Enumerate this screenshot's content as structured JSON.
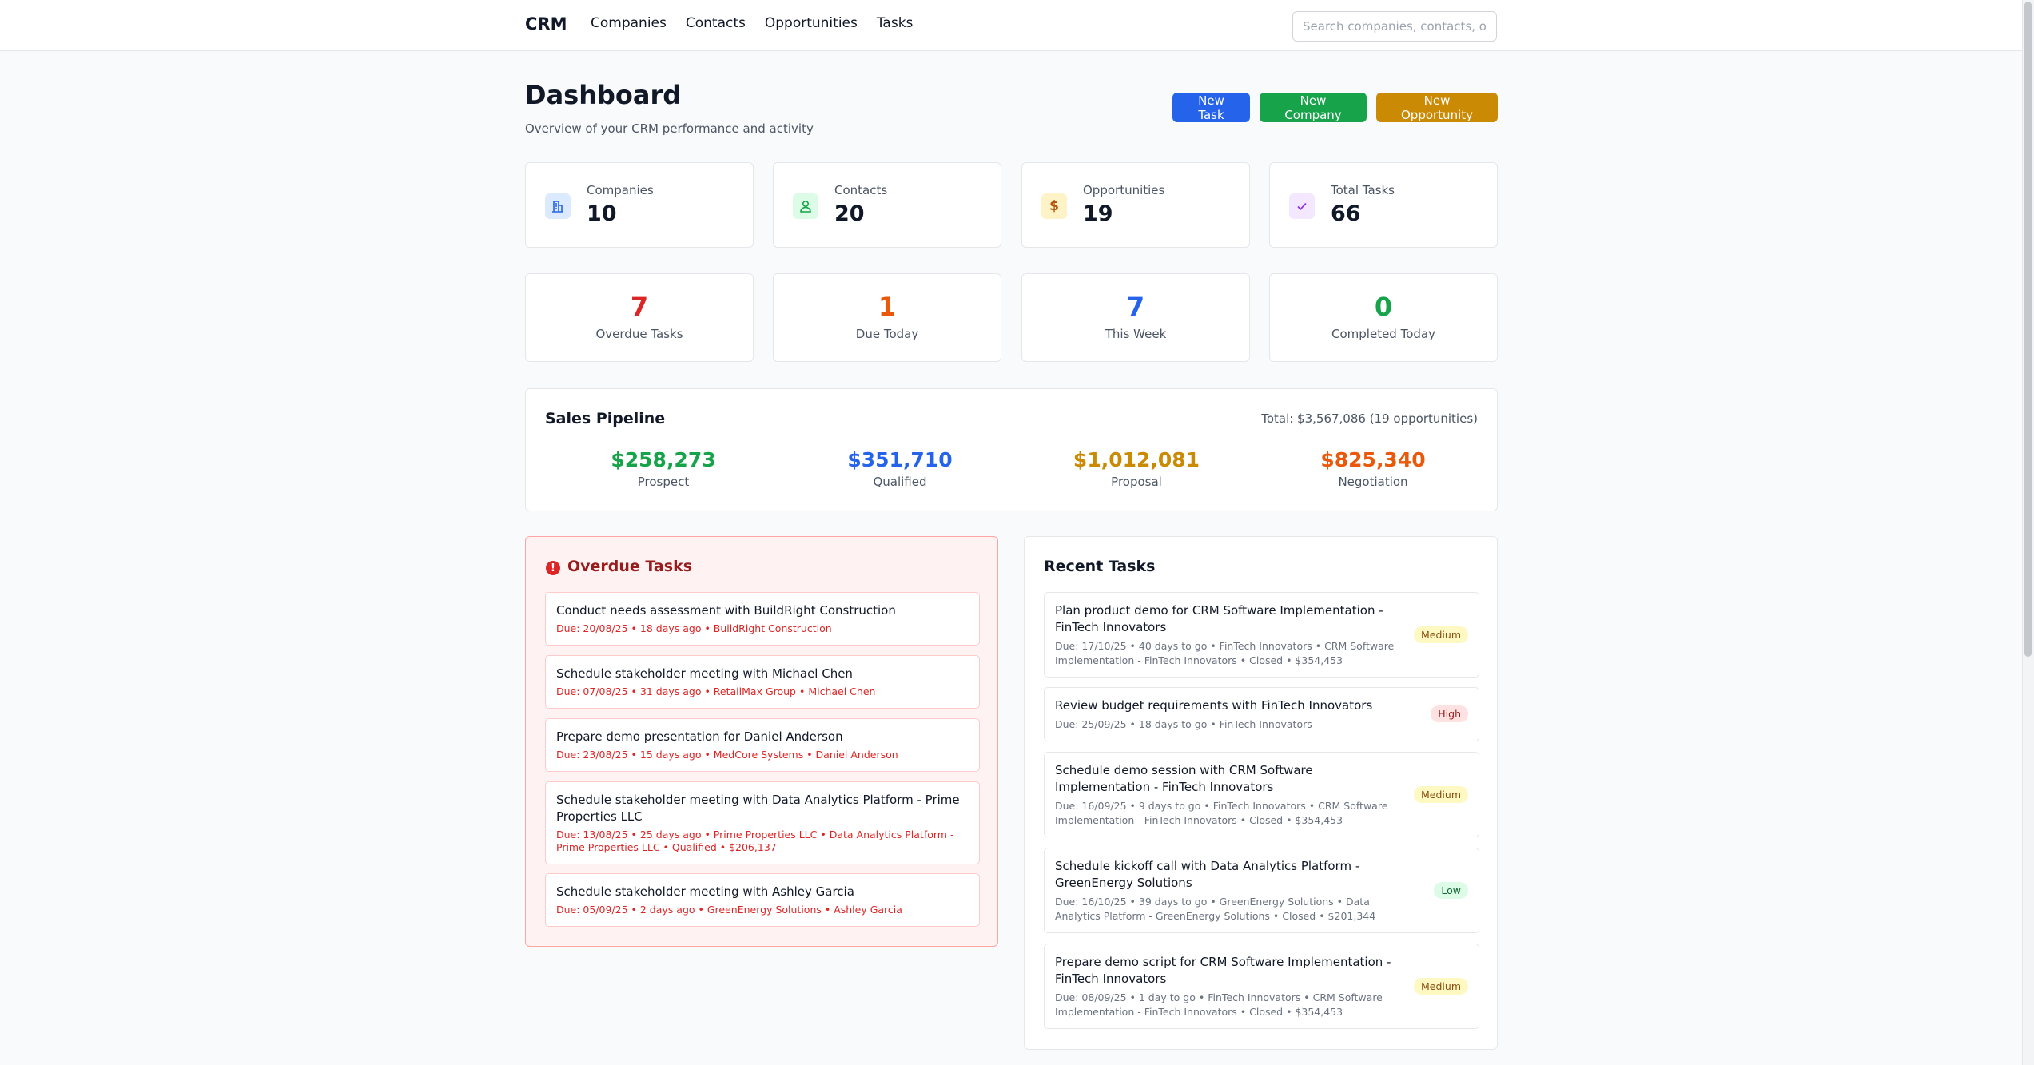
{
  "nav": {
    "brand": "CRM",
    "links": [
      "Companies",
      "Contacts",
      "Opportunities",
      "Tasks"
    ],
    "search_placeholder": "Search companies, contacts, opportunities..."
  },
  "header": {
    "title": "Dashboard",
    "subtitle": "Overview of your CRM performance and activity",
    "buttons": {
      "new_task": "New Task",
      "new_company": "New Company",
      "new_opportunity": "New Opportunity"
    }
  },
  "stats": [
    {
      "label": "Companies",
      "value": "10",
      "icon": "building-icon"
    },
    {
      "label": "Contacts",
      "value": "20",
      "icon": "person-icon"
    },
    {
      "label": "Opportunities",
      "value": "19",
      "icon": "dollar-icon"
    },
    {
      "label": "Total Tasks",
      "value": "66",
      "icon": "check-icon"
    }
  ],
  "metrics": [
    {
      "value": "7",
      "label": "Overdue Tasks",
      "color": "#dc2626"
    },
    {
      "value": "1",
      "label": "Due Today",
      "color": "#ea580c"
    },
    {
      "value": "7",
      "label": "This Week",
      "color": "#2563eb"
    },
    {
      "value": "0",
      "label": "Completed Today",
      "color": "#16a34a"
    }
  ],
  "pipeline": {
    "title": "Sales Pipeline",
    "total": "Total: $3,567,086 (19 opportunities)",
    "stages": [
      {
        "amount": "$258,273",
        "name": "Prospect",
        "color": "#16a34a"
      },
      {
        "amount": "$351,710",
        "name": "Qualified",
        "color": "#2563eb"
      },
      {
        "amount": "$1,012,081",
        "name": "Proposal",
        "color": "#ca8a04"
      },
      {
        "amount": "$825,340",
        "name": "Negotiation",
        "color": "#ea580c"
      }
    ]
  },
  "overdue": {
    "title": "Overdue Tasks",
    "tasks": [
      {
        "title": "Conduct needs assessment with BuildRight Construction",
        "meta": "Due: 20/08/25 • 18 days ago • BuildRight Construction"
      },
      {
        "title": "Schedule stakeholder meeting with Michael Chen",
        "meta": "Due: 07/08/25 • 31 days ago • RetailMax Group • Michael Chen"
      },
      {
        "title": "Prepare demo presentation for Daniel Anderson",
        "meta": "Due: 23/08/25 • 15 days ago • MedCore Systems • Daniel Anderson"
      },
      {
        "title": "Schedule stakeholder meeting with Data Analytics Platform - Prime Properties LLC",
        "meta": "Due: 13/08/25 • 25 days ago • Prime Properties LLC • Data Analytics Platform - Prime Properties LLC • Qualified • $206,137"
      },
      {
        "title": "Schedule stakeholder meeting with Ashley Garcia",
        "meta": "Due: 05/09/25 • 2 days ago • GreenEnergy Solutions • Ashley Garcia"
      }
    ]
  },
  "recent": {
    "title": "Recent Tasks",
    "tasks": [
      {
        "title": "Plan product demo for CRM Software Implementation - FinTech Innovators",
        "meta": "Due: 17/10/25 • 40 days to go • FinTech Innovators • CRM Software Implementation - FinTech Innovators • Closed • $354,453",
        "priority": "Medium"
      },
      {
        "title": "Review budget requirements with FinTech Innovators",
        "meta": "Due: 25/09/25 • 18 days to go • FinTech Innovators",
        "priority": "High"
      },
      {
        "title": "Schedule demo session with CRM Software Implementation - FinTech Innovators",
        "meta": "Due: 16/09/25 • 9 days to go • FinTech Innovators • CRM Software Implementation - FinTech Innovators • Closed • $354,453",
        "priority": "Medium"
      },
      {
        "title": "Schedule kickoff call with Data Analytics Platform - GreenEnergy Solutions",
        "meta": "Due: 16/10/25 • 39 days to go • GreenEnergy Solutions • Data Analytics Platform - GreenEnergy Solutions • Closed • $201,344",
        "priority": "Low"
      },
      {
        "title": "Prepare demo script for CRM Software Implementation - FinTech Innovators",
        "meta": "Due: 08/09/25 • 1 day to go • FinTech Innovators • CRM Software Implementation - FinTech Innovators • Closed • $354,453",
        "priority": "Medium"
      }
    ]
  }
}
